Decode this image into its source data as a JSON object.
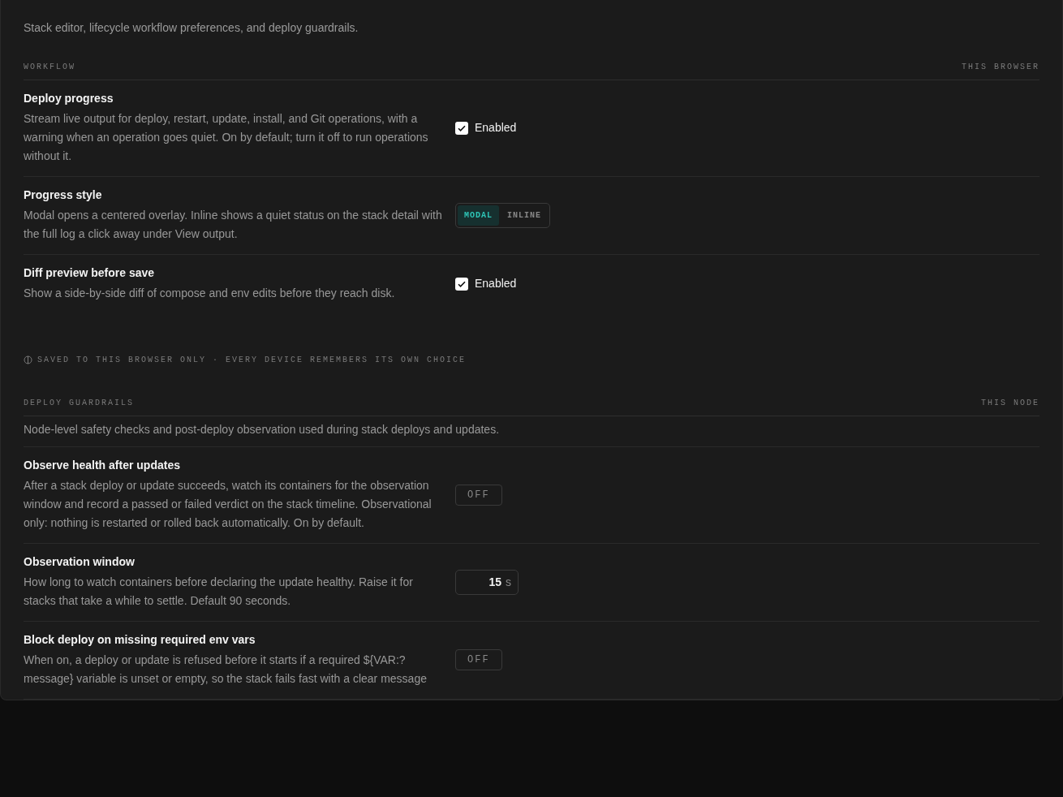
{
  "intro": "Stack editor, lifecycle workflow preferences, and deploy guardrails.",
  "sections": [
    {
      "title": "WORKFLOW",
      "scope": "THIS BROWSER",
      "rows": [
        {
          "kind": "checkbox",
          "title": "Deploy progress",
          "description": "Stream live output for deploy, restart, update, install, and Git operations, with a warning when an operation goes quiet. On by default; turn it off to run operations without it.",
          "label": "Enabled",
          "checked": true
        },
        {
          "kind": "segmented",
          "title": "Progress style",
          "description": "Modal opens a centered overlay. Inline shows a quiet status on the stack detail with the full log a click away under View output.",
          "options": [
            {
              "label": "MODAL",
              "selected": true
            },
            {
              "label": "INLINE",
              "selected": false
            }
          ]
        },
        {
          "kind": "checkbox",
          "title": "Diff preview before save",
          "description": "Show a side-by-side diff of compose and env edits before they reach disk.",
          "label": "Enabled",
          "checked": true
        }
      ],
      "note": "SAVED TO THIS BROWSER ONLY · EVERY DEVICE REMEMBERS ITS OWN CHOICE"
    },
    {
      "title": "DEPLOY GUARDRAILS",
      "scope": "THIS NODE",
      "description": "Node-level safety checks and post-deploy observation used during stack deploys and updates.",
      "rows": [
        {
          "kind": "toggle",
          "title": "Observe health after updates",
          "description": "After a stack deploy or update succeeds, watch its containers for the observation window and record a passed or failed verdict on the stack timeline. Observational only: nothing is restarted or rolled back automatically. On by default.",
          "label": "OFF",
          "on": false
        },
        {
          "kind": "number",
          "title": "Observation window",
          "description": "How long to watch containers before declaring the update healthy. Raise it for stacks that take a while to settle. Default 90 seconds.",
          "value": "15",
          "unit": "s"
        },
        {
          "kind": "toggle",
          "title": "Block deploy on missing required env vars",
          "description": "When on, a deploy or update is refused before it starts if a required ${VAR:?message} variable is unset or empty, so the stack fails fast with a clear message",
          "label": "OFF",
          "on": false
        }
      ]
    }
  ]
}
